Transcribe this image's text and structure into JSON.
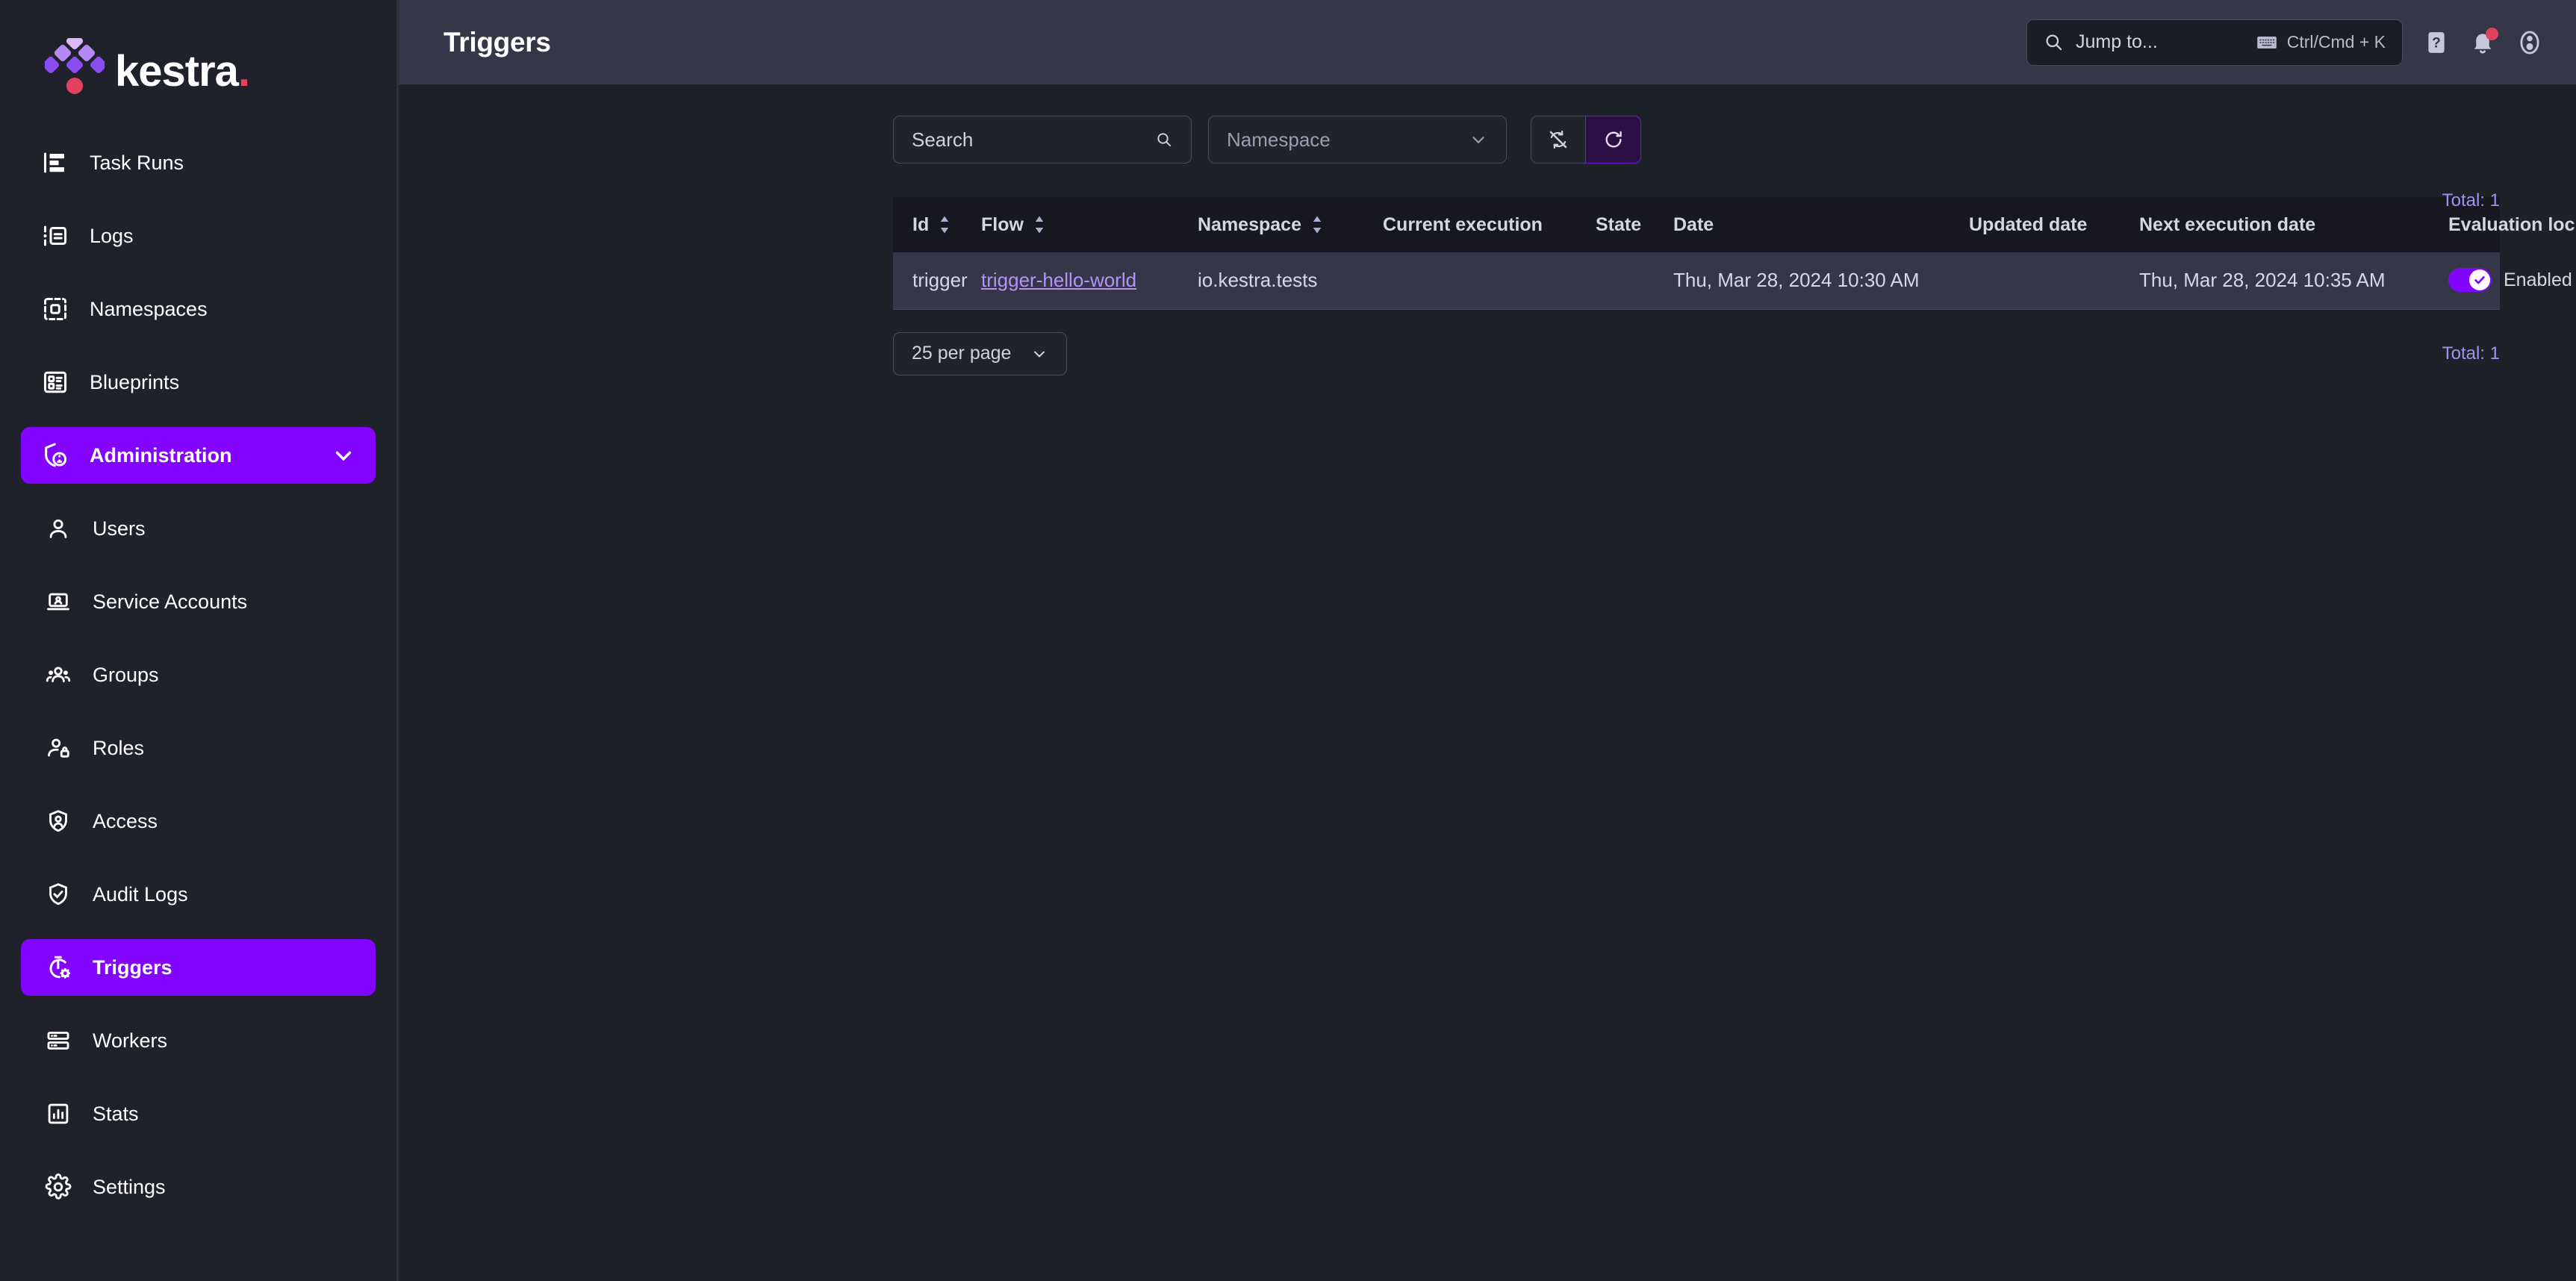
{
  "brand": {
    "name": "kestra",
    "dot": ".",
    "logo_colors": [
      "#d9b8fb",
      "#b388f7",
      "#a46ef5",
      "#8b4df2",
      "#7c3af0",
      "#8f5bf4"
    ],
    "dot_color": "#e4415f"
  },
  "sidebar": {
    "items": [
      {
        "label": "Task Runs",
        "icon": "task-runs-icon",
        "level": "top",
        "active": false
      },
      {
        "label": "Logs",
        "icon": "logs-icon",
        "level": "top",
        "active": false
      },
      {
        "label": "Namespaces",
        "icon": "namespaces-icon",
        "level": "top",
        "active": false
      },
      {
        "label": "Blueprints",
        "icon": "blueprints-icon",
        "level": "top",
        "active": false
      },
      {
        "label": "Administration",
        "icon": "administration-icon",
        "level": "group",
        "active": true
      },
      {
        "label": "Users",
        "icon": "user-icon",
        "level": "sub",
        "active": false
      },
      {
        "label": "Service Accounts",
        "icon": "service-account-icon",
        "level": "sub",
        "active": false
      },
      {
        "label": "Groups",
        "icon": "groups-icon",
        "level": "sub",
        "active": false
      },
      {
        "label": "Roles",
        "icon": "roles-icon",
        "level": "sub",
        "active": false
      },
      {
        "label": "Access",
        "icon": "access-shield-icon",
        "level": "sub",
        "active": false
      },
      {
        "label": "Audit Logs",
        "icon": "audit-logs-icon",
        "level": "sub",
        "active": false
      },
      {
        "label": "Triggers",
        "icon": "triggers-icon",
        "level": "sub",
        "active": true
      },
      {
        "label": "Workers",
        "icon": "workers-icon",
        "level": "sub",
        "active": false
      },
      {
        "label": "Stats",
        "icon": "stats-icon",
        "level": "sub",
        "active": false
      },
      {
        "label": "Settings",
        "icon": "settings-gear-icon",
        "level": "sub",
        "active": false
      }
    ]
  },
  "header": {
    "title": "Triggers",
    "jump_to_placeholder": "Jump to...",
    "shortcut": "Ctrl/Cmd + K",
    "help_icon": "help-icon",
    "notifications_icon": "bell-icon",
    "account_icon": "account-icon"
  },
  "filters": {
    "search_placeholder": "Search",
    "namespace_placeholder": "Namespace",
    "auto_refresh_icon": "auto-refresh-off-icon",
    "refresh_icon": "refresh-icon"
  },
  "table": {
    "total_top": "Total: 1",
    "total_bottom": "Total: 1",
    "per_page": "25 per page",
    "columns": [
      {
        "label": "Id",
        "sortable": true
      },
      {
        "label": "Flow",
        "sortable": true
      },
      {
        "label": "Namespace",
        "sortable": true
      },
      {
        "label": "Current execution",
        "sortable": false
      },
      {
        "label": "State",
        "sortable": false
      },
      {
        "label": "Date",
        "sortable": false
      },
      {
        "label": "Updated date",
        "sortable": false
      },
      {
        "label": "Next execution date",
        "sortable": false
      },
      {
        "label": "Evaluation lock date",
        "sortable": false
      }
    ],
    "rows": [
      {
        "id": "trigger",
        "flow": "trigger-hello-world",
        "namespace": "io.kestra.tests",
        "current_execution": "",
        "state": "",
        "date": "Thu, Mar 28, 2024 10:30 AM",
        "updated_date": "",
        "next_execution_date": "Thu, Mar 28, 2024 10:35 AM",
        "evaluation_lock_date": "",
        "enabled_label": "Enabled",
        "enabled": true
      }
    ]
  },
  "colors": {
    "accent": "#8405ff",
    "link": "#b394f5",
    "total": "#a092f0",
    "sidebar_bg": "#20222b",
    "topbar_bg": "#353749",
    "page_bg": "#1f2129",
    "table_header_bg": "#17181f",
    "row_bg": "#353749",
    "badge": "#e4415f"
  }
}
